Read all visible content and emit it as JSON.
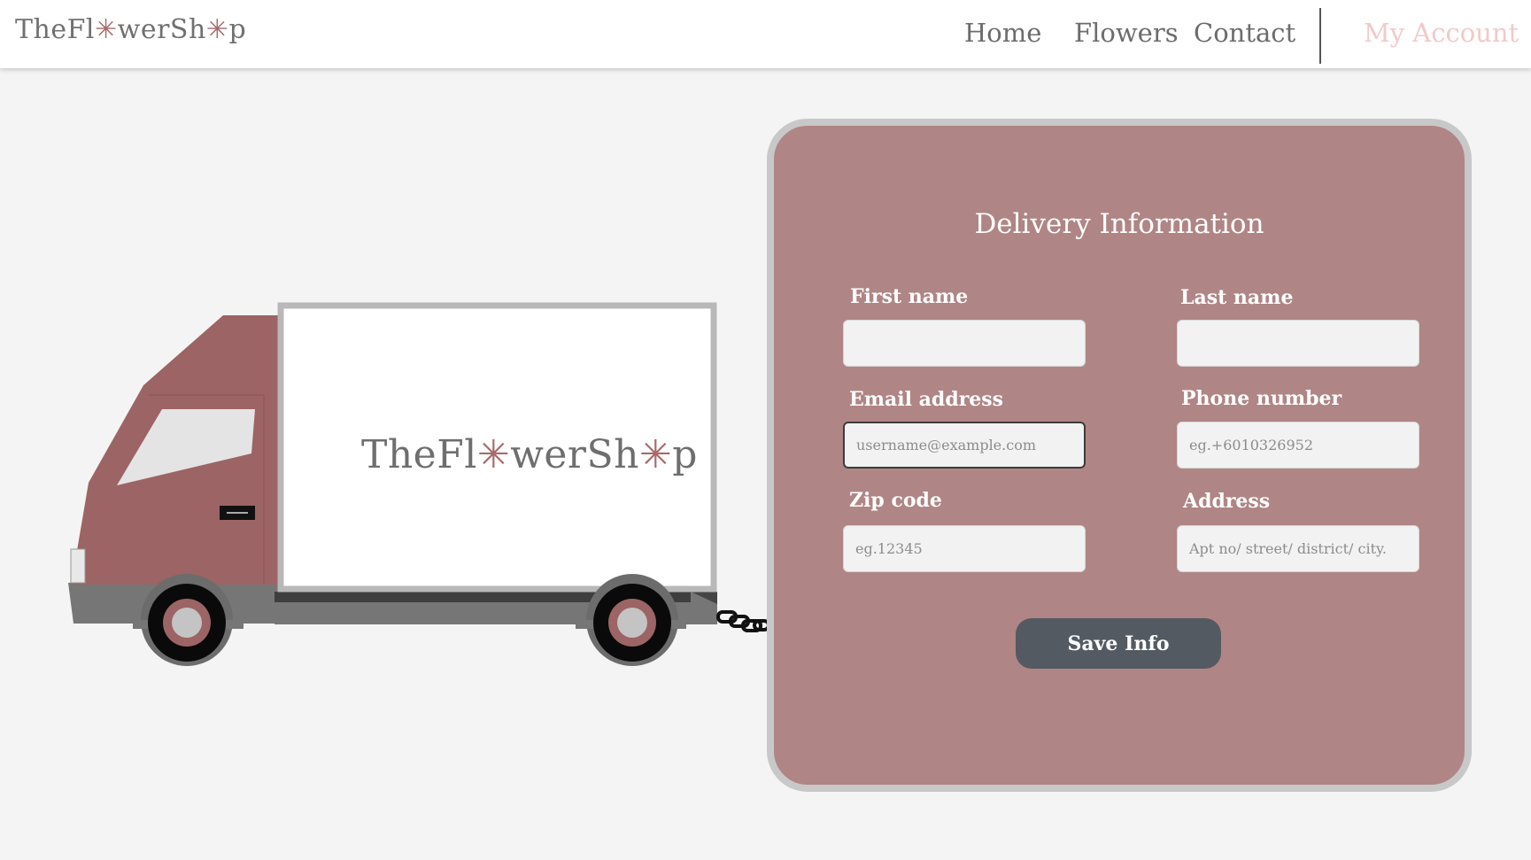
{
  "nav": {
    "logo_parts": [
      "TheFl",
      "✳",
      "werSh",
      "✳",
      "p"
    ],
    "links": [
      "Home",
      "Flowers",
      "Contact"
    ],
    "account": "My Account"
  },
  "truck": {
    "logo_parts": [
      "TheFl",
      "✳",
      "werSh",
      "✳",
      "p"
    ]
  },
  "form": {
    "title": "Delivery Information",
    "first_name": {
      "label": "First name",
      "value": "",
      "placeholder": ""
    },
    "last_name": {
      "label": "Last name",
      "value": "",
      "placeholder": ""
    },
    "email": {
      "label": "Email address",
      "value": "",
      "placeholder": "username@example.com"
    },
    "phone": {
      "label": "Phone number",
      "value": "",
      "placeholder": "eg.+6010326952"
    },
    "zip": {
      "label": "Zip code",
      "value": "",
      "placeholder": "eg.12345"
    },
    "address": {
      "label": "Address",
      "value": "",
      "placeholder": "Apt no/ street/ district/ city."
    },
    "save_label": "Save Info"
  },
  "colors": {
    "card_bg": "#b08585",
    "truck_cab": "#9c6464",
    "accent_pink": "#f3c9ca",
    "button_bg": "#545a62"
  }
}
